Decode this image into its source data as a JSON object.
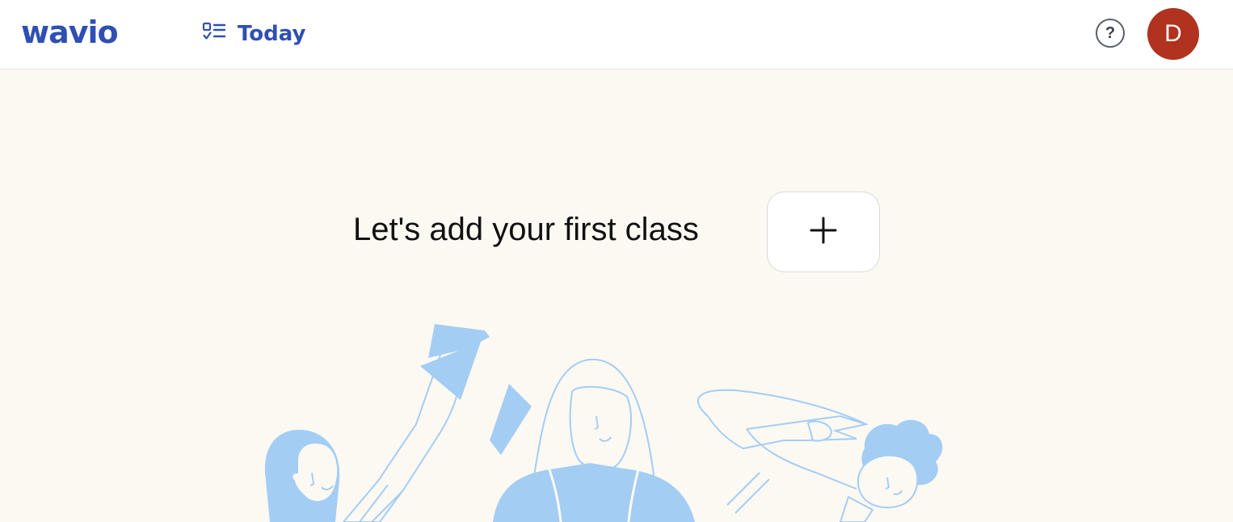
{
  "header": {
    "logo": "wavio",
    "nav": {
      "label": "Today",
      "icon": "checklist-icon"
    },
    "help_icon": "help-question-icon",
    "avatar_initial": "D",
    "avatar_color": "#b0321f",
    "accent_color": "#2f4fb5"
  },
  "main": {
    "empty_state_title": "Let's add your first class",
    "add_button_icon": "plus-icon",
    "illustration": "students-illustration",
    "illustration_color": "#a4cdf3"
  }
}
